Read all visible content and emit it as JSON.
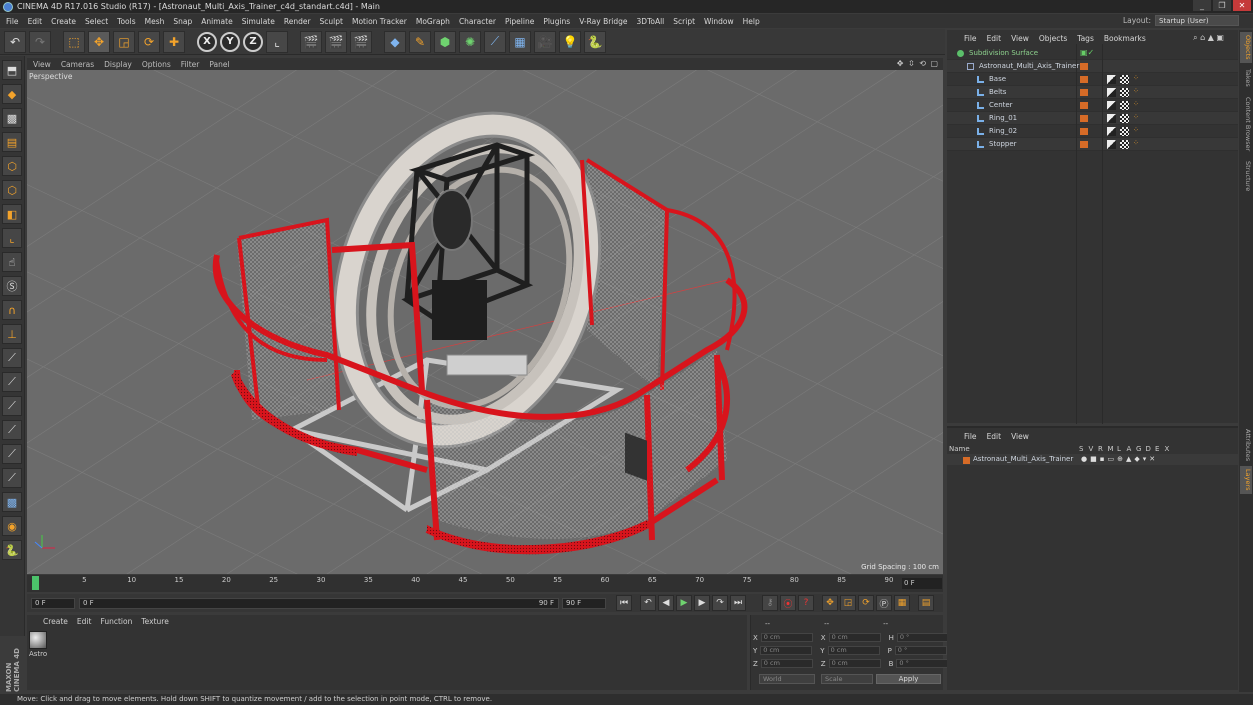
{
  "window": {
    "title": "CINEMA 4D R17.016 Studio (R17) - [Astronaut_Multi_Axis_Trainer_c4d_standart.c4d] - Main",
    "controls": [
      "_",
      "❐",
      "✕"
    ]
  },
  "menubar": {
    "items": [
      "File",
      "Edit",
      "Create",
      "Select",
      "Tools",
      "Mesh",
      "Snap",
      "Animate",
      "Simulate",
      "Render",
      "Sculpt",
      "Motion Tracker",
      "MoGraph",
      "Character",
      "Pipeline",
      "Plugins",
      "V-Ray Bridge",
      "3DToAll",
      "Script",
      "Window",
      "Help"
    ],
    "layout_label": "Layout:",
    "layout_value": "Startup (User)"
  },
  "toolbar": {
    "undo": "↶",
    "redo": "↷",
    "x": "X",
    "y": "Y",
    "z": "Z"
  },
  "viewport": {
    "menu": [
      "View",
      "Cameras",
      "Display",
      "Options",
      "Filter",
      "Panel"
    ],
    "label": "Perspective",
    "grid_spacing": "Grid Spacing : 100 cm",
    "nav_icons": "✥ ⇳ ⟲ ▢"
  },
  "timeline": {
    "ticks": [
      "0",
      "5",
      "10",
      "15",
      "20",
      "25",
      "30",
      "35",
      "40",
      "45",
      "50",
      "55",
      "60",
      "65",
      "70",
      "75",
      "80",
      "85",
      "90"
    ],
    "current_frame": "0 F"
  },
  "transport": {
    "start": "0 F",
    "slider_start": "0 F",
    "slider_end": "90 F",
    "end": "90 F"
  },
  "materials": {
    "menu": [
      "Create",
      "Edit",
      "Function",
      "Texture"
    ],
    "items": [
      {
        "label": "Astro"
      }
    ]
  },
  "branding": "MAXON CINEMA 4D",
  "coordinates": {
    "headers": [
      "--",
      "--",
      "--"
    ],
    "rows": [
      {
        "a": "X",
        "av": "0 cm",
        "b": "X",
        "bv": "0 cm",
        "c": "H",
        "cv": "0 °"
      },
      {
        "a": "Y",
        "av": "0 cm",
        "b": "Y",
        "bv": "0 cm",
        "c": "P",
        "cv": "0 °"
      },
      {
        "a": "Z",
        "av": "0 cm",
        "b": "Z",
        "bv": "0 cm",
        "c": "B",
        "cv": "0 °"
      }
    ],
    "space": "World",
    "mode": "Scale",
    "apply": "Apply"
  },
  "status": "Move: Click and drag to move elements. Hold down SHIFT to quantize movement / add to the selection in point mode, CTRL to remove.",
  "object_manager": {
    "menu": [
      "File",
      "Edit",
      "View",
      "Objects",
      "Tags",
      "Bookmarks"
    ],
    "objects": [
      {
        "name": "Subdivision Surface",
        "indent": 0,
        "kind": "subdiv"
      },
      {
        "name": "Astronaut_Multi_Axis_Trainer",
        "indent": 1,
        "kind": "null"
      },
      {
        "name": "Base",
        "indent": 2,
        "kind": "poly"
      },
      {
        "name": "Belts",
        "indent": 2,
        "kind": "poly"
      },
      {
        "name": "Center",
        "indent": 2,
        "kind": "poly"
      },
      {
        "name": "Ring_01",
        "indent": 2,
        "kind": "poly"
      },
      {
        "name": "Ring_02",
        "indent": 2,
        "kind": "poly"
      },
      {
        "name": "Stopper",
        "indent": 2,
        "kind": "poly"
      }
    ]
  },
  "attribute_manager": {
    "menu": [
      "File",
      "Edit",
      "View"
    ],
    "columns": [
      "Name",
      "S",
      "V",
      "R",
      "M",
      "L",
      "A",
      "G",
      "D",
      "E",
      "X"
    ],
    "row_name": "Astronaut_Multi_Axis_Trainer"
  },
  "right_tabs": [
    "Objects",
    "Takes",
    "Content Browser",
    "Structure",
    "Attributes",
    "Layers"
  ],
  "colors": {
    "accent": "#f3a32b",
    "fence_red": "#d8141c",
    "viewport_bg": "#6b6b6b"
  }
}
